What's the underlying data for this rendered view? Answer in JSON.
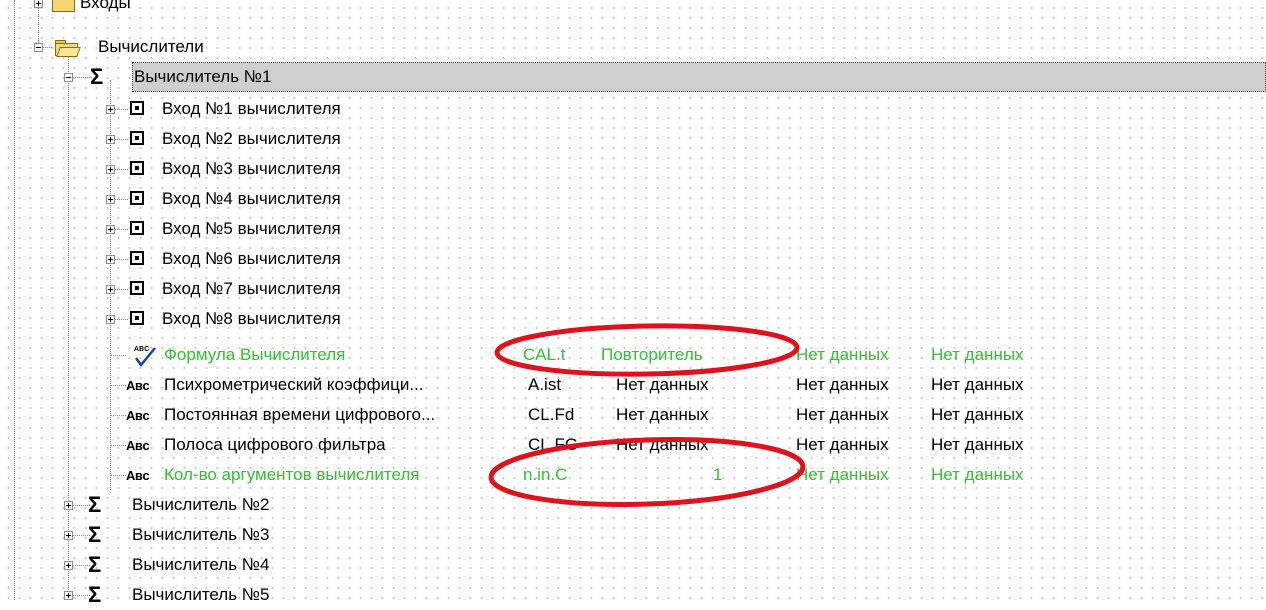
{
  "tree": {
    "top_folder_partial": "Входы",
    "calculators_folder": "Вычислители",
    "calc1": {
      "label": "Вычислитель №1",
      "inputs": [
        "Вход №1 вычислителя",
        "Вход №2 вычислителя",
        "Вход №3 вычислителя",
        "Вход №4 вычислителя",
        "Вход №5 вычислителя",
        "Вход №6 вычислителя",
        "Вход №7 вычислителя",
        "Вход №8 вычислителя"
      ],
      "params": [
        {
          "name": "Формула Вычислителя",
          "code": "CAL.t",
          "value": "Повторитель",
          "col3": "Нет данных",
          "col4": "Нет данных",
          "highlighted": true,
          "icon": "abc-check-icon"
        },
        {
          "name": "Психрометрический коэффици...",
          "code": "A.ist",
          "value": "Нет данных",
          "col3": "Нет данных",
          "col4": "Нет данных",
          "highlighted": false,
          "icon": "abc-icon"
        },
        {
          "name": "Постоянная времени цифрового...",
          "code": "CL.Fd",
          "value": "Нет данных",
          "col3": "Нет данных",
          "col4": "Нет данных",
          "highlighted": false,
          "icon": "abc-icon"
        },
        {
          "name": "Полоса цифрового фильтра",
          "code": "CL.FG",
          "value": "Нет данных",
          "col3": "Нет данных",
          "col4": "Нет данных",
          "highlighted": false,
          "icon": "abc-icon"
        },
        {
          "name": "Кол-во аргументов вычислителя",
          "code": "n.in.C",
          "value": "1",
          "col3": "Нет данных",
          "col4": "Нет данных",
          "highlighted": true,
          "icon": "abc-icon"
        }
      ]
    },
    "other_calcs": [
      "Вычислитель №2",
      "Вычислитель №3",
      "Вычислитель №4",
      "Вычислитель №5"
    ],
    "abc_glyph": "Aʙc",
    "abc_check_glyph": "ᴬᴮᶜ"
  },
  "colors": {
    "highlight_text": "#2ec42e",
    "annotation": "#e0101c",
    "selection": "#cfcfcf"
  }
}
